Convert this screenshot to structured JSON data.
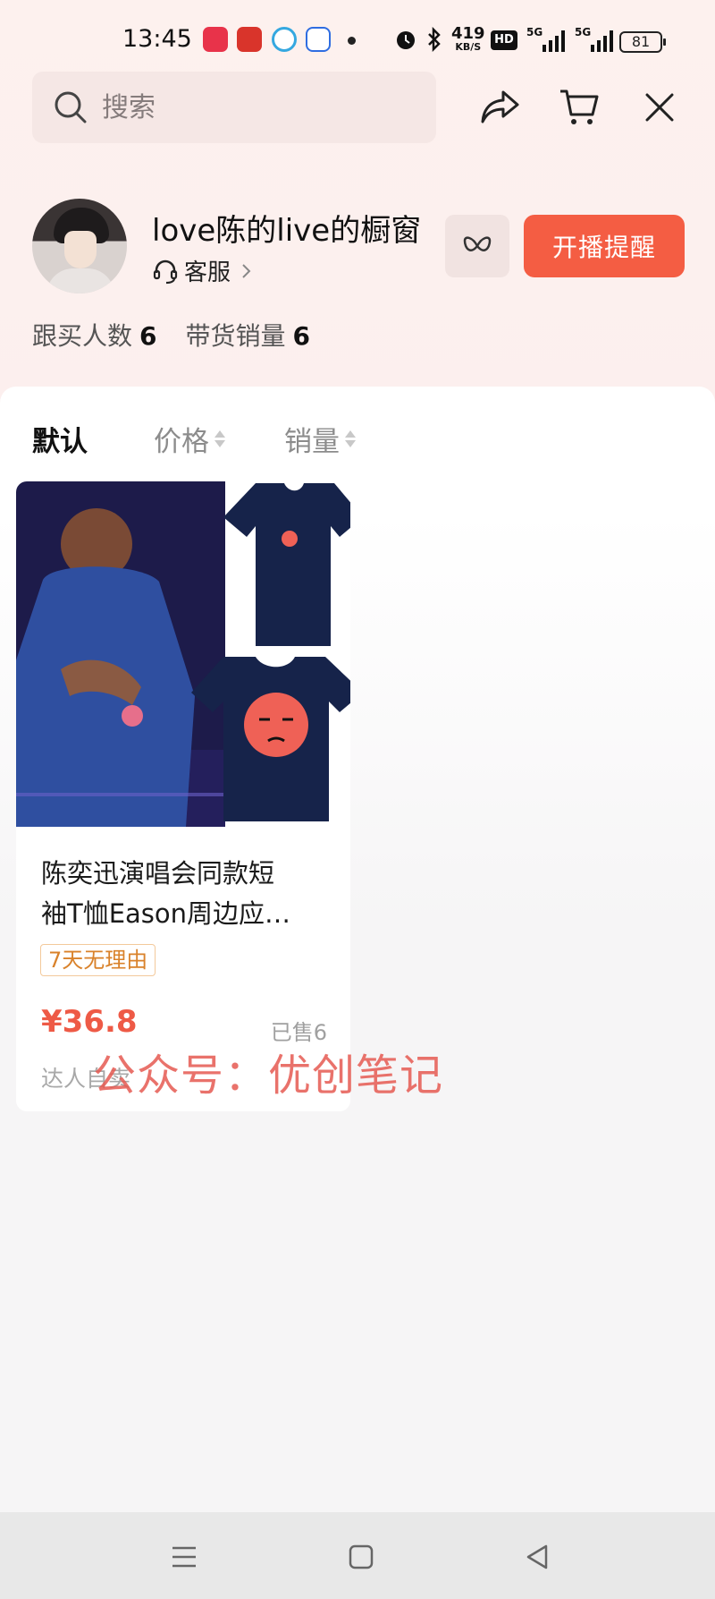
{
  "status_bar": {
    "time": "13:45",
    "net_speed_value": "419",
    "net_speed_unit": "KB/S",
    "battery": "81",
    "icons": [
      "alarm-icon",
      "bluetooth-icon",
      "hd-icon",
      "5g-signal-icon",
      "5g-signal-icon"
    ]
  },
  "search": {
    "placeholder": "搜索"
  },
  "shop": {
    "name": "love陈的live的橱窗",
    "service_label": "客服",
    "remind_button": "开播提醒",
    "followers_label": "跟买人数",
    "followers_value": "6",
    "sales_label": "带货销量",
    "sales_value": "6"
  },
  "sort": {
    "default": "默认",
    "price": "价格",
    "sales": "销量"
  },
  "products": [
    {
      "title_line1": "陈奕迅演唱会同款短",
      "title_line2": "袖T恤Eason周边应…",
      "tag": "7天无理由",
      "price": "¥36.8",
      "sold": "已售6",
      "seller": "达人自卖"
    }
  ],
  "watermark": "公众号：优创笔记",
  "colors": {
    "accent": "#f45d43",
    "price": "#ee5a46",
    "tag": "#d9822b"
  }
}
